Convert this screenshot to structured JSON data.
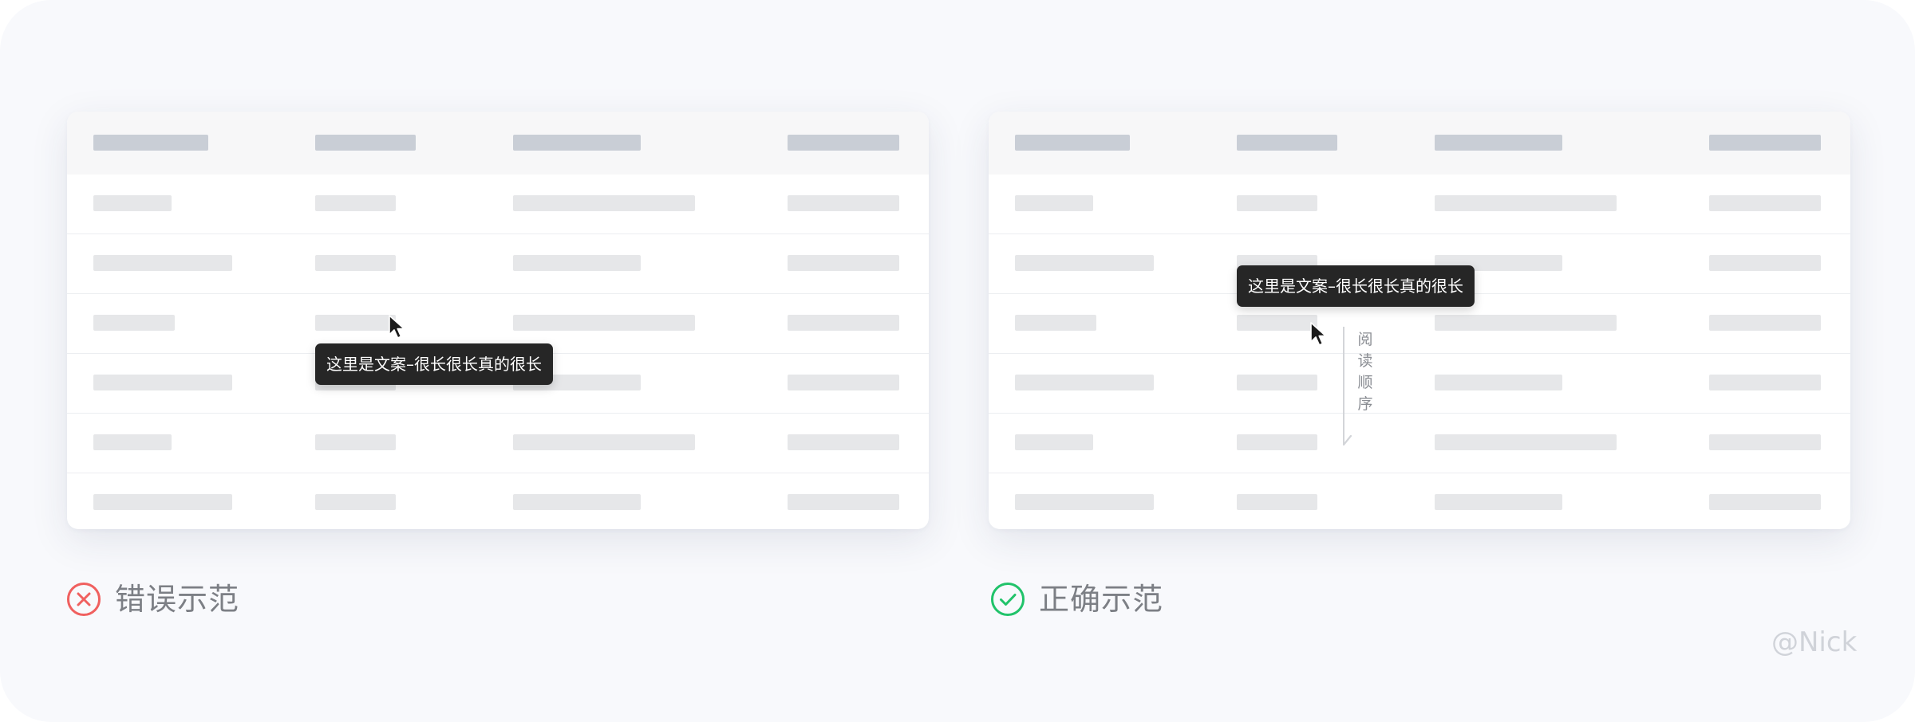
{
  "tooltip_text": "这里是文案–很长很长真的很长",
  "reading_order_label": "阅读顺序",
  "wrong_example": {
    "label": "错误示范",
    "icon": "error-circle-icon",
    "color": "#f0605f"
  },
  "correct_example": {
    "label": "正确示范",
    "icon": "check-circle-icon",
    "color": "#21c36a"
  },
  "watermark": "@Nick",
  "colors": {
    "background": "#f8f9fc",
    "card": "#ffffff",
    "header_bar": "#c9ced6",
    "body_bar": "#e6e7e9",
    "tooltip_bg": "#262626"
  }
}
